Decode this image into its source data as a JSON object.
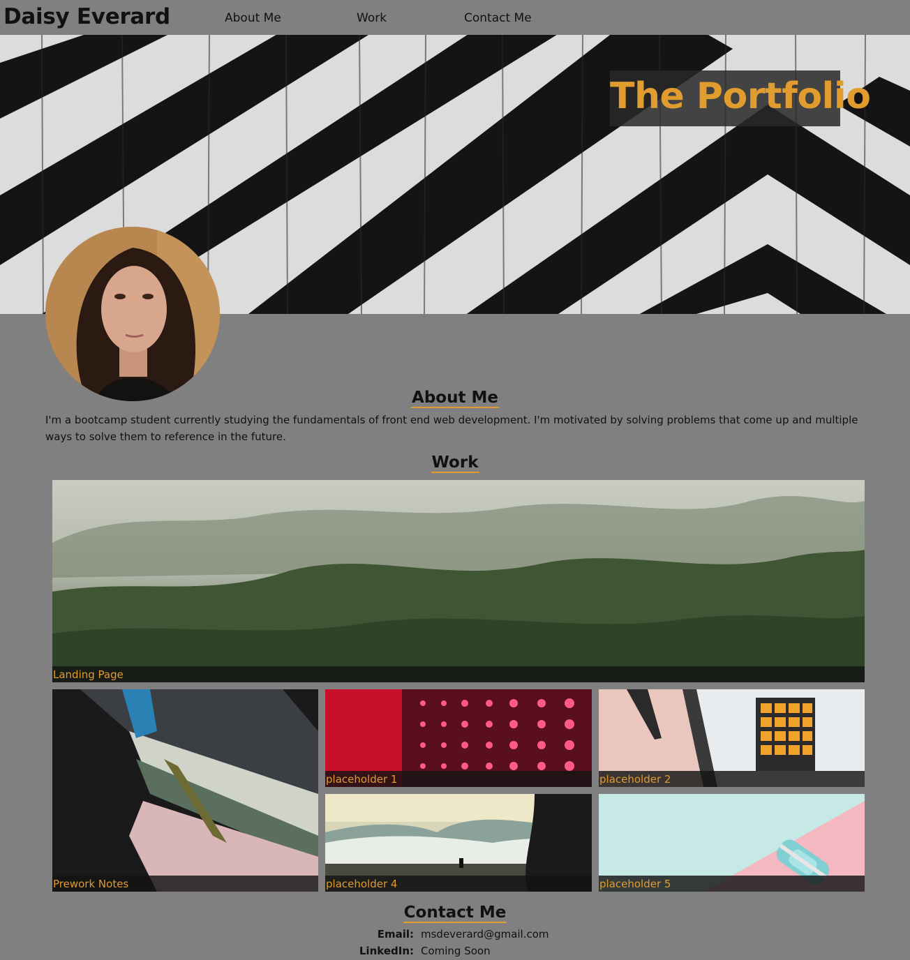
{
  "nav": {
    "brand": "Daisy Everard",
    "links": [
      {
        "label": "About Me"
      },
      {
        "label": "Work"
      },
      {
        "label": "Contact Me"
      }
    ]
  },
  "hero": {
    "title": "The Portfolio"
  },
  "about": {
    "heading": "About Me",
    "text": "I'm a bootcamp student currently studying the fundamentals of front end web development. I'm motivated by solving problems that come up and multiple ways to solve them to reference in the future."
  },
  "work": {
    "heading": "Work",
    "projects": [
      {
        "caption": "Landing Page"
      },
      {
        "caption": "Prework Notes"
      },
      {
        "caption": "placeholder 1"
      },
      {
        "caption": "placeholder 2"
      },
      {
        "caption": "placeholder 4"
      },
      {
        "caption": "placeholder 5"
      }
    ]
  },
  "contact": {
    "heading": "Contact Me",
    "rows": [
      {
        "label": "Email:",
        "value": "msdeverard@gmail.com"
      },
      {
        "label": "LinkedIn:",
        "value": "Coming Soon"
      }
    ]
  },
  "colors": {
    "background": "#808080",
    "accent": "#e09c2f",
    "caption_bg": "#141414"
  }
}
